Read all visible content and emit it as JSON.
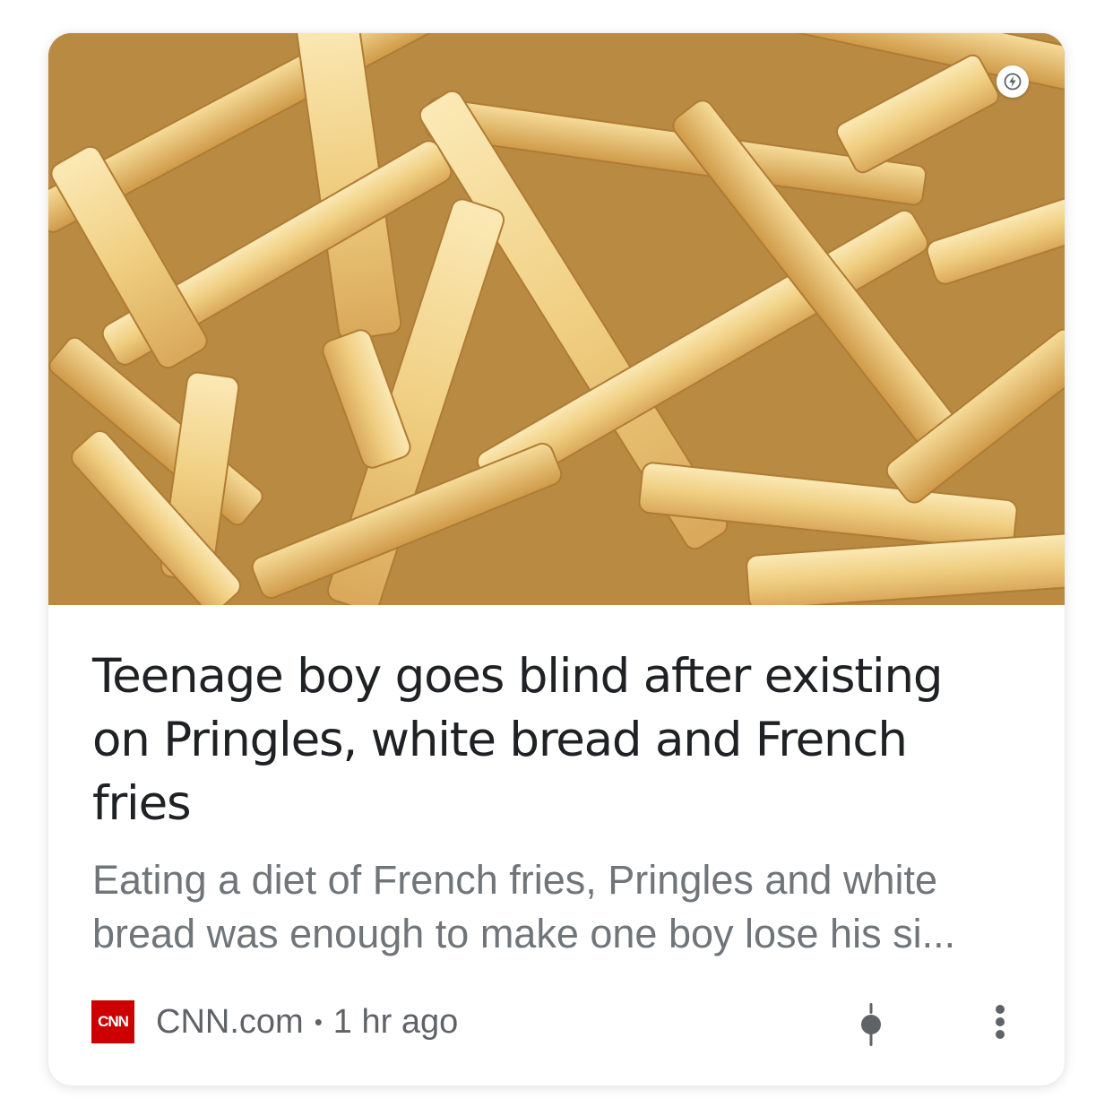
{
  "article": {
    "image_alt": "French fries",
    "amp_icon": "lightning-bolt-icon",
    "headline_lines": [
      "Teenage boy goes blind after existing",
      "on Pringles, white bread and French",
      "fries"
    ],
    "snippet_lines": [
      "Eating a diet of French fries, Pringles and white",
      "bread was enough to make one boy lose his si..."
    ],
    "source": {
      "logo_text": "CNN",
      "name": "CNN.com",
      "separator": "•",
      "time": "1 hr ago"
    },
    "actions": {
      "pin_icon": "pin-icon",
      "more_icon": "more-vert-icon"
    }
  },
  "colors": {
    "headline": "#202124",
    "snippet": "#70757a",
    "meta": "#5f6368",
    "cnn_red": "#cc0000"
  }
}
